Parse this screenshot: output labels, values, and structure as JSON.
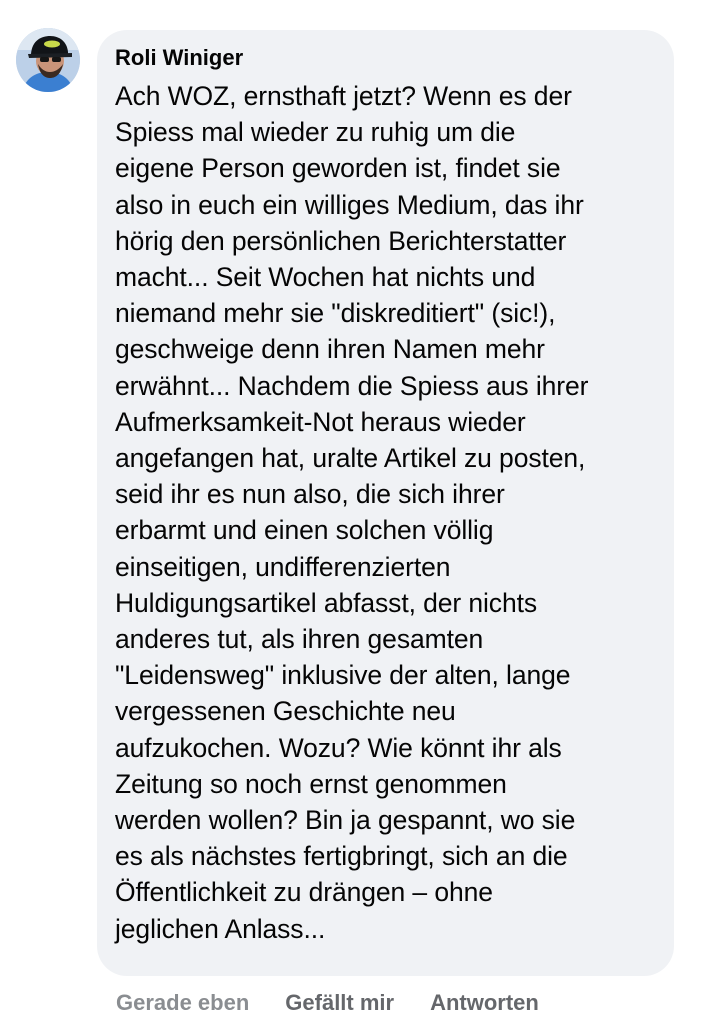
{
  "comment": {
    "author": "Roli Winiger",
    "avatar_icon": "user-avatar-photo",
    "text": "Ach WOZ, ernsthaft jetzt? Wenn es der\nSpiess mal wieder zu ruhig um die\neigene Person geworden ist, findet sie\nalso in euch ein williges Medium, das ihr\nhörig den persönlichen Berichterstatter\nmacht... Seit Wochen hat nichts und\nniemand mehr sie \"diskreditiert\" (sic!),\ngeschweige denn ihren Namen mehr\nerwähnt... Nachdem die Spiess aus ihrer\nAufmerksamkeit-Not heraus wieder\nangefangen hat, uralte Artikel zu posten,\nseid ihr es nun also, die sich ihrer\nerbarmt und einen solchen völlig\neinseitigen, undifferenzierten\nHuldigungsartikel abfasst, der nichts\nanderes tut, als ihren gesamten\n\"Leidensweg\" inklusive der alten, lange\nvergessenen Geschichte neu\naufzukochen. Wozu? Wie könnt ihr als\nZeitung so noch ernst genommen\nwerden wollen? Bin ja gespannt, wo sie\nes als nächstes fertigbringt, sich an die\nÖffentlichkeit zu drängen – ohne\njeglichen Anlass..."
  },
  "actions": {
    "timestamp": "Gerade eben",
    "like_label": "Gefällt mir",
    "reply_label": "Antworten"
  },
  "colors": {
    "bubble_background": "#f0f2f5",
    "text": "#050505",
    "secondary_text": "#65676b"
  }
}
